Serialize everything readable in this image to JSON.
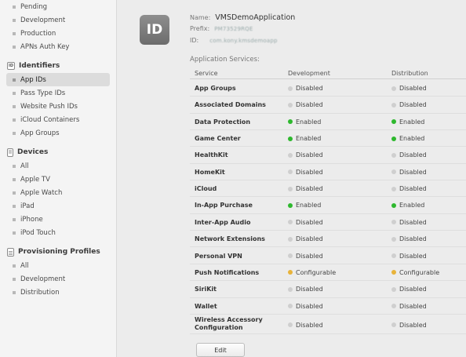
{
  "sidebar": {
    "certificates_tail": [
      "Pending",
      "Development",
      "Production",
      "APNs Auth Key"
    ],
    "identifiers": {
      "title": "Identifiers",
      "items": [
        "App IDs",
        "Pass Type IDs",
        "Website Push IDs",
        "iCloud Containers",
        "App Groups"
      ],
      "active": "App IDs"
    },
    "devices": {
      "title": "Devices",
      "items": [
        "All",
        "Apple TV",
        "Apple Watch",
        "iPad",
        "iPhone",
        "iPod Touch"
      ]
    },
    "profiles": {
      "title": "Provisioning Profiles",
      "items": [
        "All",
        "Development",
        "Distribution"
      ]
    }
  },
  "app": {
    "badge": "ID",
    "name_label": "Name:",
    "name": "VMSDemoApplication",
    "prefix_label": "Prefix:",
    "prefix": "PM73529RQE",
    "id_label": "ID:",
    "id": "com.kony.kmsdemoapp"
  },
  "services": {
    "title": "Application Services:",
    "columns": [
      "Service",
      "Development",
      "Distribution"
    ],
    "rows": [
      {
        "service": "App Groups",
        "development": "Disabled",
        "distribution": "Disabled"
      },
      {
        "service": "Associated Domains",
        "development": "Disabled",
        "distribution": "Disabled"
      },
      {
        "service": "Data Protection",
        "development": "Enabled",
        "distribution": "Enabled"
      },
      {
        "service": "Game Center",
        "development": "Enabled",
        "distribution": "Enabled"
      },
      {
        "service": "HealthKit",
        "development": "Disabled",
        "distribution": "Disabled"
      },
      {
        "service": "HomeKit",
        "development": "Disabled",
        "distribution": "Disabled"
      },
      {
        "service": "iCloud",
        "development": "Disabled",
        "distribution": "Disabled"
      },
      {
        "service": "In-App Purchase",
        "development": "Enabled",
        "distribution": "Enabled"
      },
      {
        "service": "Inter-App Audio",
        "development": "Disabled",
        "distribution": "Disabled"
      },
      {
        "service": "Network Extensions",
        "development": "Disabled",
        "distribution": "Disabled"
      },
      {
        "service": "Personal VPN",
        "development": "Disabled",
        "distribution": "Disabled"
      },
      {
        "service": "Push Notifications",
        "development": "Configurable",
        "distribution": "Configurable"
      },
      {
        "service": "SiriKit",
        "development": "Disabled",
        "distribution": "Disabled"
      },
      {
        "service": "Wallet",
        "development": "Disabled",
        "distribution": "Disabled"
      },
      {
        "service": "Wireless Accessory Configuration",
        "development": "Disabled",
        "distribution": "Disabled"
      }
    ]
  },
  "actions": {
    "edit_label": "Edit"
  },
  "colors": {
    "enabled": "#2eb82e",
    "disabled": "#cfcfcf",
    "configurable": "#e8b33a"
  }
}
